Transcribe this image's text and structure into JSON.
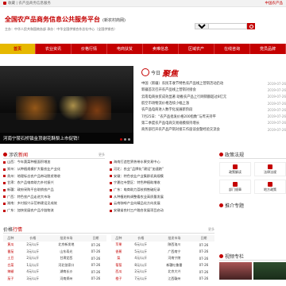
{
  "topbar": {
    "home_text": "收藏 | 农产品商务信息服务",
    "right_text": "中国农产品"
  },
  "header": {
    "title": "全国农产品商务信息公共服务平台",
    "subtitle": "(新农村商网)",
    "host_line": "主办：中华人民共和国商务部   承办：中华全国供销合作总社中心（全国供销合）"
  },
  "search": {
    "select_label": "新闻",
    "placeholder": ""
  },
  "nav": [
    "首页",
    "农业资讯",
    "价格行情",
    "电商扶贫",
    "卖难信息",
    "区域农产",
    "在线咨询",
    "党员品牌"
  ],
  "hero": {
    "caption": "河南宁陵石桥镇金顶谢花酥梨上市促销！"
  },
  "today": {
    "prefix": "今日",
    "brand": "聚焦",
    "items": [
      {
        "title": "中国（新疆）农民丰收节特色农产品线上营销活动启动",
        "date": "2019-07-26"
      },
      {
        "title": "新疆首次召开农产品线上营销对接会",
        "date": "2019-07-26"
      },
      {
        "title": "云南电商扶贫成效显著 助推农产品上行网销额超过8亿元",
        "date": "2019-07-26"
      },
      {
        "title": "航空市场物流价格连续小幅上涨",
        "date": "2019-07-26"
      },
      {
        "title": "农产品电商进入数字化发展新阶段",
        "date": "2019-07-26"
      },
      {
        "title": "7月25日：“农产品批发价格200指数”与昨天持平",
        "date": "2019-07-26"
      },
      {
        "title": "第二季度农产品电商交易规模保持增长",
        "date": "2019-07-26"
      },
      {
        "title": "商务部召开农产品产销对接工作座谈会暨经验交流会",
        "date": "2019-07-26"
      }
    ]
  },
  "agri_news": {
    "title_plain": "涉农",
    "title_red": "新闻",
    "more": "更多",
    "items": [
      "山西：今年蔬菜种植面积增加",
      "郑州：从种植规模扩大看农业产业化",
      "贵州：地理标志农产品带动脱贫增收",
      "甘肃：农产品电商助力乡村振兴",
      "新疆：政府采购平台助销农产品",
      "广西：特色农产品走进大市场",
      "湖南：乡村振兴示范带建设见成效",
      "广东：加快发展农产品冷链物流"
    ]
  },
  "announcements": {
    "items": [
      "海南打造世界热带水果交易中心",
      "河北：农业“品牌化”建设“加速跑”",
      "安徽：特色农业产业集群初具规模",
      "宁夏红寺堡区：特色种植助增收",
      "广东：电商助力荔枝销售破纪录",
      "从种植结构调整看农业高质量发展",
      "云南咖啡产业向精品化方向发展",
      "安徽省农村三产融合发展项目启动"
    ]
  },
  "policy": {
    "title": "政策法规",
    "cards": [
      "政策解读",
      "法律法规",
      "部门规章",
      "地方政策",
      "政策要闻",
      "通知公告",
      "标准规范",
      "统计数据"
    ]
  },
  "ads": {
    "title": "推介专题"
  },
  "prices": {
    "title_plain": "价格",
    "title_red": "行情",
    "more": "更多",
    "columns": [
      "品种",
      "价格",
      "批发市场",
      "日期"
    ],
    "left": [
      {
        "name": "黄瓜",
        "price": "2元/公斤",
        "market": "北京新发地",
        "date": "07-26"
      },
      {
        "name": "番茄",
        "price": "3元/公斤",
        "market": "山东寿光",
        "date": "07-26"
      },
      {
        "name": "土豆",
        "price": "2元/公斤",
        "market": "甘肃定西",
        "date": "07-26"
      },
      {
        "name": "白菜",
        "price": "1元/公斤",
        "market": "河北张家口",
        "date": "07-26"
      },
      {
        "name": "辣椒",
        "price": "4元/公斤",
        "market": "湖南长沙",
        "date": "07-26"
      },
      {
        "name": "茄子",
        "price": "3元/公斤",
        "market": "河南郑州",
        "date": "07-26"
      }
    ],
    "right": [
      {
        "name": "苹果",
        "price": "6元/公斤",
        "market": "陕西洛川",
        "date": "07-26"
      },
      {
        "name": "香蕉",
        "price": "5元/公斤",
        "market": "广西南宁",
        "date": "07-26"
      },
      {
        "name": "梨",
        "price": "4元/公斤",
        "market": "河南宁陵",
        "date": "07-26"
      },
      {
        "name": "葡萄",
        "price": "8元/公斤",
        "market": "新疆吐鲁番",
        "date": "07-26"
      },
      {
        "name": "西瓜",
        "price": "2元/公斤",
        "market": "北京大兴",
        "date": "07-26"
      },
      {
        "name": "橙子",
        "price": "7元/公斤",
        "market": "江西赣州",
        "date": "07-26"
      }
    ]
  },
  "video": {
    "title": "视频专栏"
  }
}
